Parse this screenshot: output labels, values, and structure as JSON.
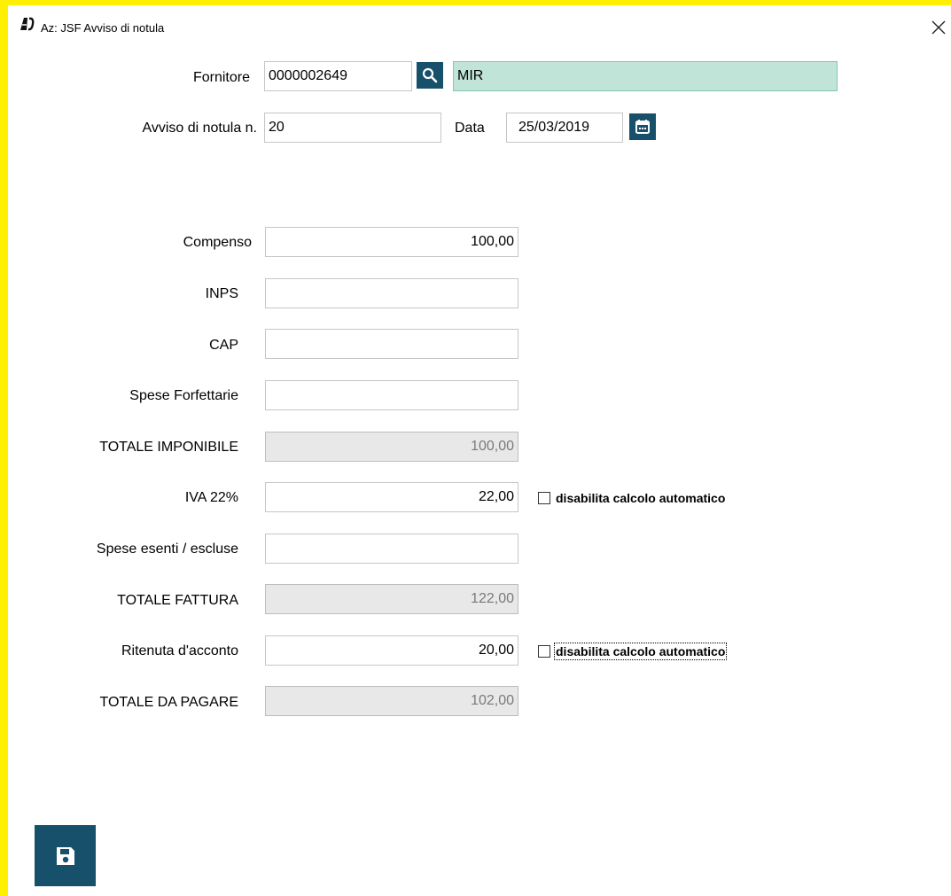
{
  "window": {
    "title": "Az: JSF Avviso di notula"
  },
  "header": {
    "fornitore_label": "Fornitore",
    "fornitore_code": "0000002649",
    "fornitore_name": "MIR",
    "avviso_label": "Avviso di notula n.",
    "avviso_number": "20",
    "data_label": "Data",
    "data_value": "25/03/2019"
  },
  "rows": [
    {
      "label": "Compenso",
      "value": "100,00",
      "readonly": false
    },
    {
      "label": "INPS",
      "value": "",
      "readonly": false
    },
    {
      "label": "CAP",
      "value": "",
      "readonly": false
    },
    {
      "label": "Spese Forfettarie",
      "value": "",
      "readonly": false
    },
    {
      "label": "TOTALE IMPONIBILE",
      "value": "100,00",
      "readonly": true
    },
    {
      "label": "IVA 22%",
      "value": "22,00",
      "readonly": false
    },
    {
      "label": "Spese esenti / escluse",
      "value": "",
      "readonly": false
    },
    {
      "label": "TOTALE FATTURA",
      "value": "122,00",
      "readonly": true
    },
    {
      "label": "Ritenuta d'acconto",
      "value": "20,00",
      "readonly": false
    },
    {
      "label": "TOTALE DA PAGARE",
      "value": "102,00",
      "readonly": true
    }
  ],
  "checkboxes": {
    "iva": {
      "label": "disabilita calcolo automatico",
      "checked": false
    },
    "ritenuta": {
      "label": "disabilita calcolo automatico",
      "checked": false
    }
  },
  "icons": {
    "app": "app-logo-icon",
    "close": "close-icon",
    "search": "search-icon",
    "calendar": "calendar-icon",
    "save": "save-icon"
  },
  "colors": {
    "frame": "#ffef00",
    "button": "#17506a",
    "supplier_name_bg": "#c0e4d7",
    "readonly_bg": "#e8e8e8"
  }
}
